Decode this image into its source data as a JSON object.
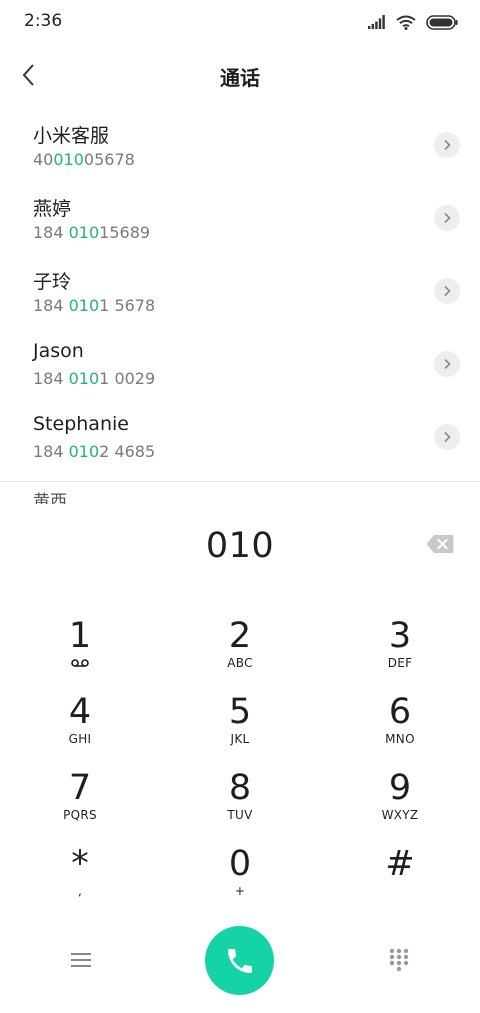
{
  "status_bar": {
    "time": "2:36"
  },
  "header": {
    "title": "通话"
  },
  "contacts": [
    {
      "name": "小米客服",
      "number_pre": "40",
      "number_match": "010",
      "number_post": "05678"
    },
    {
      "name": "燕婷",
      "number_pre": "184 ",
      "number_match": "010",
      "number_post": "15689"
    },
    {
      "name": "子玲",
      "number_pre": "184 ",
      "number_match": "010",
      "number_post": "1 5678"
    },
    {
      "name": "Jason",
      "number_pre": "184 ",
      "number_match": "010",
      "number_post": "1 0029"
    },
    {
      "name": "Stephanie",
      "number_pre": "184 ",
      "number_match": "010",
      "number_post": "2 4685"
    }
  ],
  "partial_contact": {
    "name": "黄西"
  },
  "dial": {
    "number": "010"
  },
  "keypad": [
    {
      "digit": "1",
      "letters": "",
      "sub_icon": "voicemail-icon"
    },
    {
      "digit": "2",
      "letters": "ABC"
    },
    {
      "digit": "3",
      "letters": "DEF"
    },
    {
      "digit": "4",
      "letters": "GHI"
    },
    {
      "digit": "5",
      "letters": "JKL"
    },
    {
      "digit": "6",
      "letters": "MNO"
    },
    {
      "digit": "7",
      "letters": "PQRS"
    },
    {
      "digit": "8",
      "letters": "TUV"
    },
    {
      "digit": "9",
      "letters": "WXYZ"
    },
    {
      "digit": "*",
      "letters": ","
    },
    {
      "digit": "0",
      "letters": "+"
    },
    {
      "digit": "#",
      "letters": ""
    }
  ],
  "icons": {
    "back": "chevron-left-icon",
    "detail": "chevron-right-icon",
    "backspace": "backspace-icon",
    "menu": "menu-icon",
    "call": "phone-icon",
    "dialpad": "dialpad-icon",
    "signal": "signal-icon",
    "wifi": "wifi-icon",
    "battery": "battery-icon"
  },
  "colors": {
    "accent_green": "#22b47a",
    "call_button": "#14d3a5",
    "detail_button_bg": "#eeeeee",
    "secondary_text": "#7a7a7a"
  }
}
